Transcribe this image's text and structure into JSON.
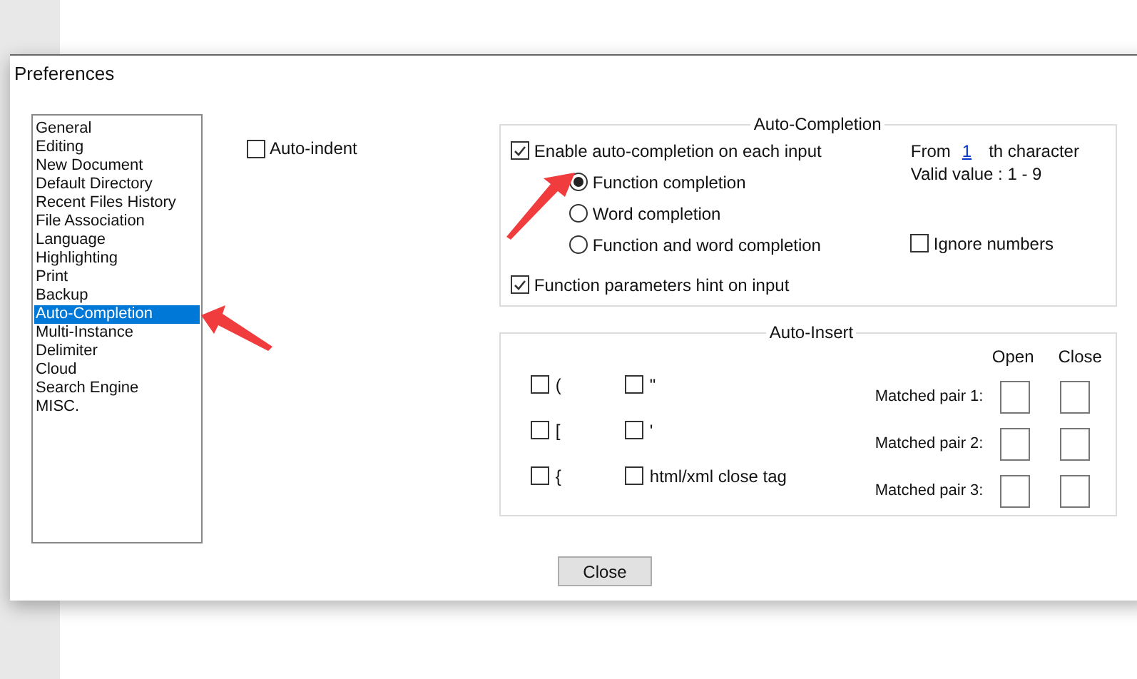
{
  "window": {
    "title": "Preferences"
  },
  "categories": [
    {
      "label": "General",
      "selected": false
    },
    {
      "label": "Editing",
      "selected": false
    },
    {
      "label": "New Document",
      "selected": false
    },
    {
      "label": "Default Directory",
      "selected": false
    },
    {
      "label": "Recent Files History",
      "selected": false
    },
    {
      "label": "File Association",
      "selected": false
    },
    {
      "label": "Language",
      "selected": false
    },
    {
      "label": "Highlighting",
      "selected": false
    },
    {
      "label": "Print",
      "selected": false
    },
    {
      "label": "Backup",
      "selected": false
    },
    {
      "label": "Auto-Completion",
      "selected": true
    },
    {
      "label": "Multi-Instance",
      "selected": false
    },
    {
      "label": "Delimiter",
      "selected": false
    },
    {
      "label": "Cloud",
      "selected": false
    },
    {
      "label": "Search Engine",
      "selected": false
    },
    {
      "label": "MISC.",
      "selected": false
    }
  ],
  "auto_indent": {
    "label": "Auto-indent",
    "checked": false
  },
  "auto_completion": {
    "title": "Auto-Completion",
    "enable": {
      "label": "Enable auto-completion on each input",
      "checked": true
    },
    "modes": [
      {
        "label": "Function completion",
        "selected": true
      },
      {
        "label": "Word completion",
        "selected": false
      },
      {
        "label": "Function and word completion",
        "selected": false
      }
    ],
    "from": {
      "prefix": "From",
      "value": "1",
      "suffix": "th character"
    },
    "valid": "Valid value : 1 - 9",
    "ignore_numbers": {
      "label": "Ignore numbers",
      "checked": false
    },
    "param_hint": {
      "label": "Function parameters hint on input",
      "checked": true
    }
  },
  "auto_insert": {
    "title": "Auto-Insert",
    "checks": [
      {
        "label": "(",
        "checked": false
      },
      {
        "label": "\"",
        "checked": false
      },
      {
        "label": "[",
        "checked": false
      },
      {
        "label": "'",
        "checked": false
      },
      {
        "label": "{",
        "checked": false
      },
      {
        "label": "html/xml close tag",
        "checked": false
      }
    ],
    "headers": [
      "Open",
      "Close"
    ],
    "pairs": [
      {
        "label": "Matched pair 1:"
      },
      {
        "label": "Matched pair 2:"
      },
      {
        "label": "Matched pair 3:"
      }
    ]
  },
  "buttons": [
    "Close"
  ]
}
